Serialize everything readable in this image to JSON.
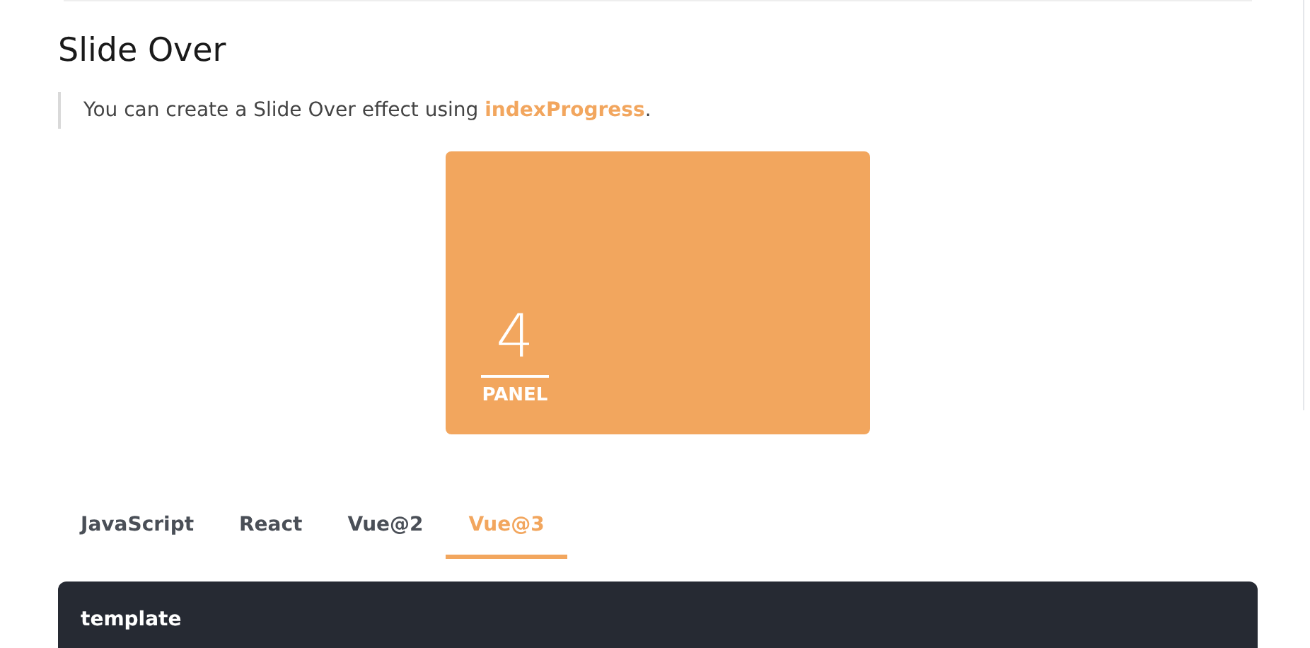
{
  "heading": "Slide Over",
  "note": "You can create a Slide Over effect using **indexProgress**.",
  "panel": {
    "number": "4",
    "label": "PANEL"
  },
  "tabs": [
    {
      "label": "JavaScript",
      "selected": false
    },
    {
      "label": "React",
      "selected": false
    },
    {
      "label": "Vue@2",
      "selected": false
    },
    {
      "label": "Vue@3",
      "selected": true
    }
  ],
  "code": {
    "title": "template"
  }
}
